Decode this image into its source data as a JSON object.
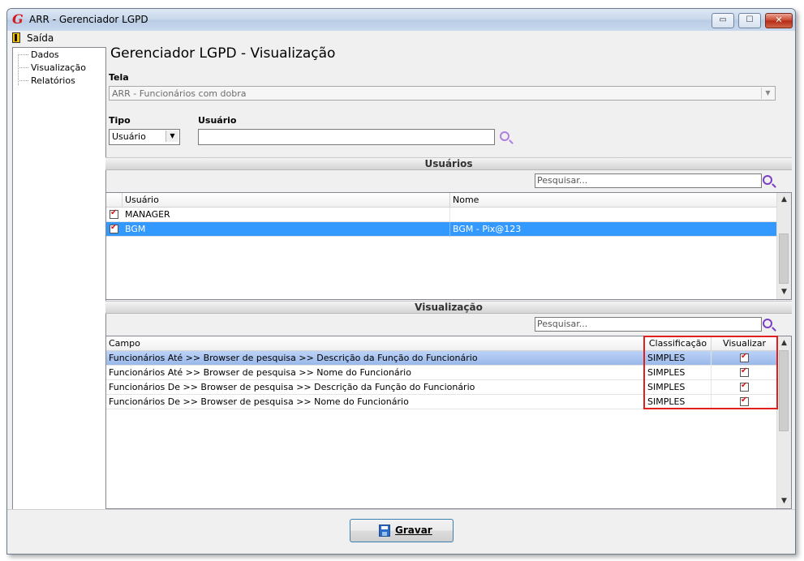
{
  "window": {
    "title": "ARR - Gerenciador LGPD",
    "logo_letter": "G",
    "controls": {
      "minimize": "▭",
      "maximize": "☐",
      "close": "✕"
    }
  },
  "menu": {
    "exit_label": "Saída"
  },
  "tree": {
    "items": [
      "Dados",
      "Visualização",
      "Relatórios"
    ]
  },
  "page": {
    "heading": "Gerenciador LGPD - Visualização",
    "tela_label": "Tela",
    "tela_value": "ARR - Funcionários com dobra",
    "tipo_label": "Tipo",
    "tipo_value": "Usuário",
    "usuario_label": "Usuário",
    "usuario_value": ""
  },
  "users_section": {
    "title": "Usuários",
    "search_placeholder": "Pesquisar...",
    "columns": [
      "Usuário",
      "Nome"
    ],
    "rows": [
      {
        "usuario": "MANAGER",
        "nome": "",
        "checked": true,
        "selected": false
      },
      {
        "usuario": "BGM",
        "nome": "BGM - Pix@123",
        "checked": true,
        "selected": true
      }
    ]
  },
  "visual_section": {
    "title": "Visualização",
    "search_placeholder": "Pesquisar...",
    "columns": [
      "Campo",
      "Classificação",
      "Visualizar"
    ],
    "rows": [
      {
        "campo": "Funcionários Até >> Browser de pesquisa >> Descrição da Função do Funcionário",
        "classificacao": "SIMPLES",
        "visualizar": true
      },
      {
        "campo": "Funcionários Até >> Browser de pesquisa >> Nome do Funcionário",
        "classificacao": "SIMPLES",
        "visualizar": true
      },
      {
        "campo": "Funcionários De >> Browser de pesquisa >> Descrição da Função do Funcionário",
        "classificacao": "SIMPLES",
        "visualizar": true
      },
      {
        "campo": "Funcionários De >> Browser de pesquisa >> Nome do Funcionário",
        "classificacao": "SIMPLES",
        "visualizar": true
      }
    ]
  },
  "footer": {
    "save_first": "G",
    "save_rest": "ravar"
  },
  "colors": {
    "accent_red": "#e01f1f",
    "selection_blue": "#3399ff",
    "search_icon": "#7b3fc4"
  }
}
